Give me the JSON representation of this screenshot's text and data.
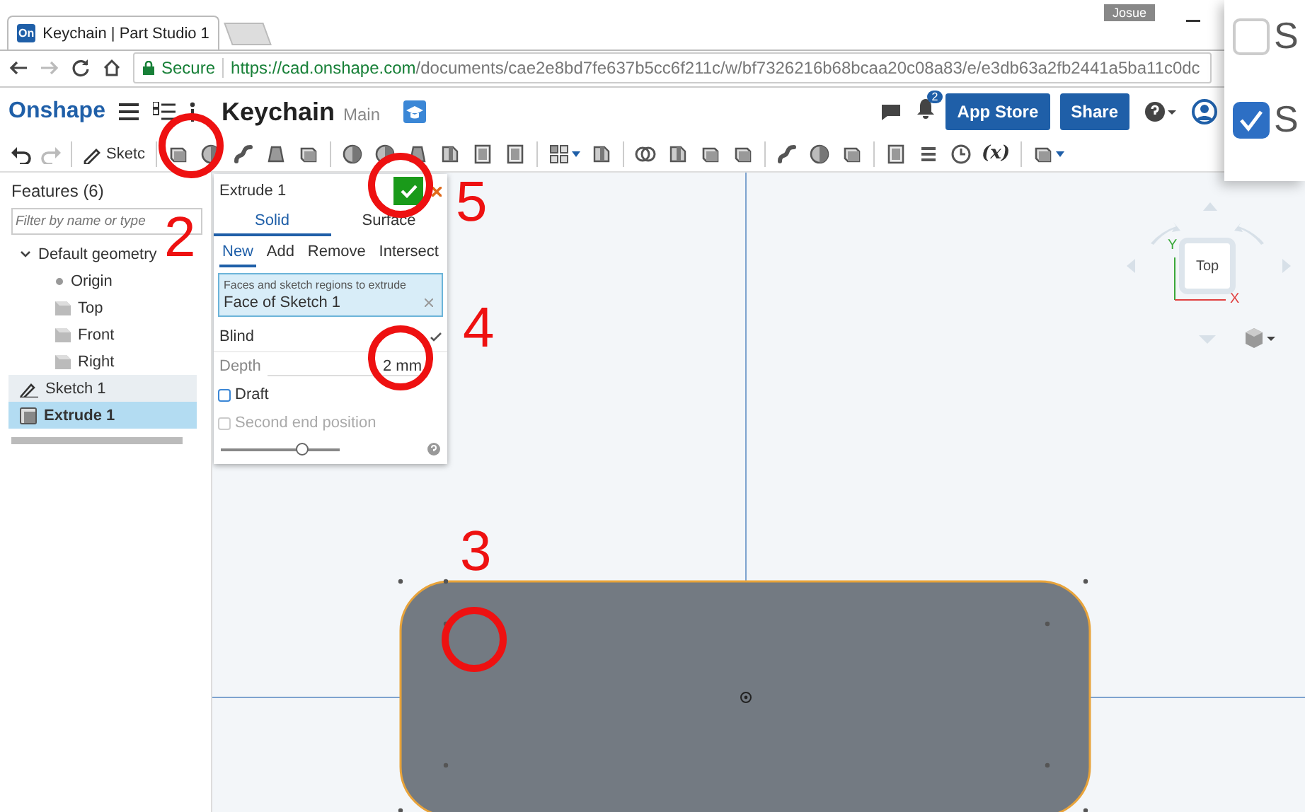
{
  "browser": {
    "tab": {
      "logo": "On",
      "title": "Keychain | Part Studio 1"
    },
    "user": "Josue",
    "secure": "Secure",
    "url_host": "https://cad.onshape.com",
    "url_path": "/documents/cae2e8bd7fe637b5cc6f211c/w/bf7326216b68bcaa20c08a83/e/e3db63a2fb2441a5ba11c0dc"
  },
  "app": {
    "logo": "Onshape",
    "document": "Keychain",
    "workspace": "Main",
    "notification_count": "2",
    "buttons": [
      {
        "label": "App Store"
      },
      {
        "label": "Share"
      }
    ]
  },
  "toolbar": {
    "sketch": "Sketc",
    "variable": "(x)"
  },
  "features": {
    "title": "Features (6)",
    "filter": {
      "placeholder": "Filter by name or type"
    },
    "tree": [
      {
        "label": "Default geometry",
        "kind": "folder",
        "expanded": true,
        "selected": false,
        "children": [
          {
            "label": "Origin",
            "kind": "point",
            "selected": false
          },
          {
            "label": "Top",
            "kind": "plane",
            "selected": false
          },
          {
            "label": "Front",
            "kind": "plane",
            "selected": false
          },
          {
            "label": "Right",
            "kind": "plane",
            "selected": false
          }
        ]
      },
      {
        "label": "Sketch 1",
        "kind": "sketch",
        "selected": false
      },
      {
        "label": "Extrude 1",
        "kind": "extrude",
        "selected": true
      }
    ]
  },
  "dialog": {
    "title": "Extrude 1",
    "body_types": [
      {
        "label": "Solid",
        "selected": true
      },
      {
        "label": "Surface",
        "selected": false
      }
    ],
    "operations": [
      {
        "label": "New",
        "selected": true
      },
      {
        "label": "Add",
        "selected": false
      },
      {
        "label": "Remove",
        "selected": false
      },
      {
        "label": "Intersect",
        "selected": false
      }
    ],
    "selection": {
      "label": "Faces and sketch regions to extrude",
      "value": "Face of Sketch 1"
    },
    "end_type": "Blind",
    "depth": {
      "label": "Depth",
      "value": "2 mm"
    },
    "options": [
      {
        "label": "Draft",
        "checked": false,
        "disabled": false
      },
      {
        "label": "Second end position",
        "checked": false,
        "disabled": true
      }
    ],
    "slider": {
      "level": 0.68
    }
  },
  "view_cube": {
    "face": "Top",
    "x_axis": "X",
    "y_axis": "Y"
  },
  "overlay_options": [
    {
      "label": "S",
      "checked": false
    },
    {
      "label": "S",
      "checked": true
    }
  ],
  "annotations": [
    {
      "label": "2"
    },
    {
      "label": "5"
    },
    {
      "label": "4"
    },
    {
      "label": "3"
    }
  ]
}
